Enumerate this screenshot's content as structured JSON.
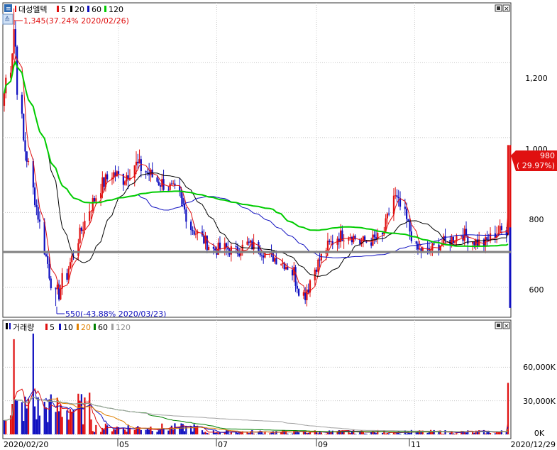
{
  "price_panel": {
    "legend": {
      "title": "대성엘텍",
      "ma": [
        {
          "label": "5",
          "color": "#e01010"
        },
        {
          "label": "20",
          "color": "#000000"
        },
        {
          "label": "60",
          "color": "#1010c0"
        },
        {
          "label": "120",
          "color": "#00cc00"
        }
      ]
    },
    "high_annotation": "1,345(37.24% 2020/02/26)",
    "low_annotation": "550(-43.88% 2020/03/23)",
    "y_ticks": [
      "1,200",
      "1,000",
      "800",
      "600"
    ],
    "current_price": "980",
    "current_change": "( 29.97%)",
    "reference_line_value": 710
  },
  "volume_panel": {
    "legend": {
      "title": "거래량",
      "ma": [
        {
          "label": "5",
          "color": "#e01010"
        },
        {
          "label": "10",
          "color": "#1010c0"
        },
        {
          "label": "20",
          "color": "#e08000"
        },
        {
          "label": "60",
          "color": "#008000"
        },
        {
          "label": "120",
          "color": "#a0a0a0"
        }
      ]
    },
    "y_ticks": [
      "60,000K",
      "30,000K",
      "0K"
    ]
  },
  "x_ticks": [
    "2020/02/20",
    "05",
    "07",
    "09",
    "11",
    "2020/12/29"
  ],
  "colors": {
    "up": "#e01010",
    "down": "#1010c0",
    "reference": "#808080",
    "last_box": "#e01010"
  },
  "chart_data": [
    {
      "type": "candlestick",
      "title": "대성엘텍",
      "date_range": [
        "2020/02/20",
        "2020/12/29"
      ],
      "ylim": [
        520,
        1360
      ],
      "grid": true,
      "key_points": [
        {
          "date": "2020/02/26",
          "value": 1345,
          "label": "1,345(37.24% 2020/02/26)"
        },
        {
          "date": "2020/03/23",
          "value": 550,
          "label": "550(-43.88% 2020/03/23)"
        },
        {
          "date": "2020/12/29",
          "value": 980,
          "label": "980 ( 29.97%)"
        }
      ],
      "series": [
        {
          "name": "5",
          "type": "line"
        },
        {
          "name": "20",
          "type": "line"
        },
        {
          "name": "60",
          "type": "line"
        },
        {
          "name": "120",
          "type": "line"
        }
      ],
      "close_path": [
        [
          "2020/02/20",
          1120
        ],
        [
          "2020/02/26",
          1300
        ],
        [
          "2020/03/02",
          1010
        ],
        [
          "2020/03/09",
          860
        ],
        [
          "2020/03/16",
          700
        ],
        [
          "2020/03/23",
          570
        ],
        [
          "2020/03/30",
          640
        ],
        [
          "2020/04/06",
          730
        ],
        [
          "2020/04/13",
          810
        ],
        [
          "2020/04/20",
          870
        ],
        [
          "2020/04/27",
          905
        ],
        [
          "2020/05/04",
          890
        ],
        [
          "2020/05/11",
          930
        ],
        [
          "2020/05/18",
          910
        ],
        [
          "2020/05/25",
          885
        ],
        [
          "2020/06/01",
          870
        ],
        [
          "2020/06/08",
          840
        ],
        [
          "2020/06/15",
          760
        ],
        [
          "2020/06/22",
          730
        ],
        [
          "2020/06/29",
          700
        ],
        [
          "2020/07/06",
          705
        ],
        [
          "2020/07/13",
          695
        ],
        [
          "2020/07/20",
          715
        ],
        [
          "2020/07/27",
          705
        ],
        [
          "2020/08/03",
          685
        ],
        [
          "2020/08/10",
          670
        ],
        [
          "2020/08/17",
          645
        ],
        [
          "2020/08/24",
          580
        ],
        [
          "2020/08/31",
          650
        ],
        [
          "2020/09/07",
          705
        ],
        [
          "2020/09/14",
          735
        ],
        [
          "2020/09/21",
          745
        ],
        [
          "2020/09/28",
          720
        ],
        [
          "2020/10/05",
          725
        ],
        [
          "2020/10/12",
          735
        ],
        [
          "2020/10/19",
          845
        ],
        [
          "2020/10/26",
          790
        ],
        [
          "2020/11/02",
          700
        ],
        [
          "2020/11/09",
          695
        ],
        [
          "2020/11/16",
          715
        ],
        [
          "2020/11/23",
          725
        ],
        [
          "2020/11/30",
          745
        ],
        [
          "2020/12/07",
          725
        ],
        [
          "2020/12/14",
          715
        ],
        [
          "2020/12/21",
          745
        ],
        [
          "2020/12/28",
          755
        ],
        [
          "2020/12/29",
          980
        ]
      ]
    },
    {
      "type": "bar",
      "title": "거래량",
      "ylim": [
        0,
        90000
      ],
      "y_unit": "K",
      "grid": true,
      "series": [
        {
          "name": "5",
          "type": "line"
        },
        {
          "name": "10",
          "type": "line"
        },
        {
          "name": "20",
          "type": "line"
        },
        {
          "name": "60",
          "type": "line"
        },
        {
          "name": "120",
          "type": "line"
        }
      ],
      "key_points": [
        {
          "date": "2020/02/26",
          "value": 85000
        },
        {
          "date": "2020/03/09",
          "value": 90000
        },
        {
          "date": "2020/12/29",
          "value": 46000
        }
      ]
    }
  ]
}
